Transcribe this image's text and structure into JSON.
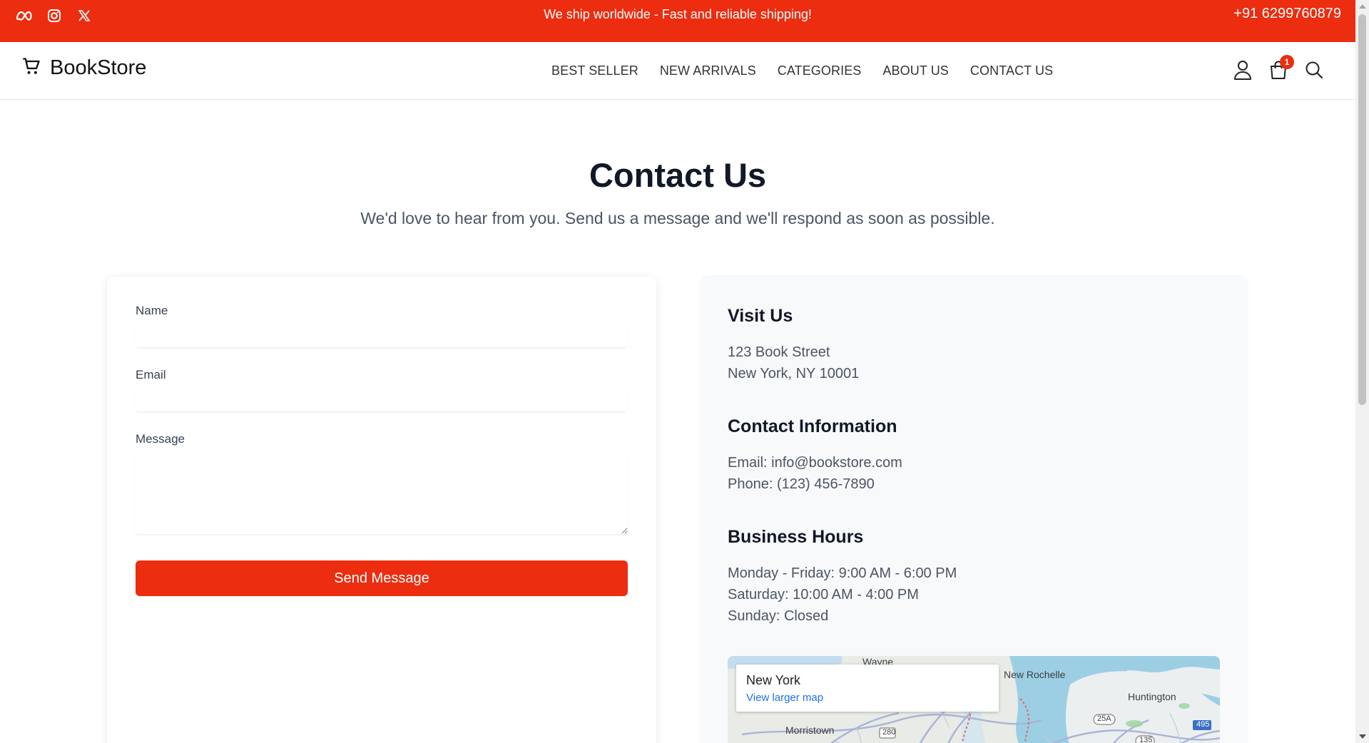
{
  "topbar": {
    "social_icons": [
      "meta-icon",
      "instagram-icon",
      "x-icon"
    ],
    "promo": "We ship worldwide - Fast and reliable shipping!",
    "phone": "+91 6299760879",
    "bg_color": "#ec2d10"
  },
  "nav": {
    "brand": "BookStore",
    "menu": [
      "BEST SELLER",
      "NEW ARRIVALS",
      "CATEGORIES",
      "ABOUT US",
      "CONTACT US"
    ],
    "cart_count": "1"
  },
  "header": {
    "title": "Contact Us",
    "subtitle": "We'd love to hear from you. Send us a message and we'll respond as soon as possible."
  },
  "form": {
    "name_label": "Name",
    "email_label": "Email",
    "message_label": "Message",
    "submit_label": "Send Message"
  },
  "info": {
    "visit_heading": "Visit Us",
    "address_line1": "123 Book Street",
    "address_line2": "New York, NY 10001",
    "contact_heading": "Contact Information",
    "email_line": "Email: info@bookstore.com",
    "phone_line": "Phone: (123) 456-7890",
    "hours_heading": "Business Hours",
    "hours_weekday": "Monday - Friday: 9:00 AM - 6:00 PM",
    "hours_saturday": "Saturday: 10:00 AM - 4:00 PM",
    "hours_sunday": "Sunday: Closed"
  },
  "map": {
    "place": "New York",
    "link": "View larger map",
    "labels": [
      "Wayne",
      "New Rochelle",
      "Huntington",
      "Morristown"
    ],
    "shields": [
      "280",
      "25A",
      "495",
      "135"
    ]
  },
  "colors": {
    "accent": "#ec2d10",
    "panel_bg": "#f8f9fa"
  }
}
